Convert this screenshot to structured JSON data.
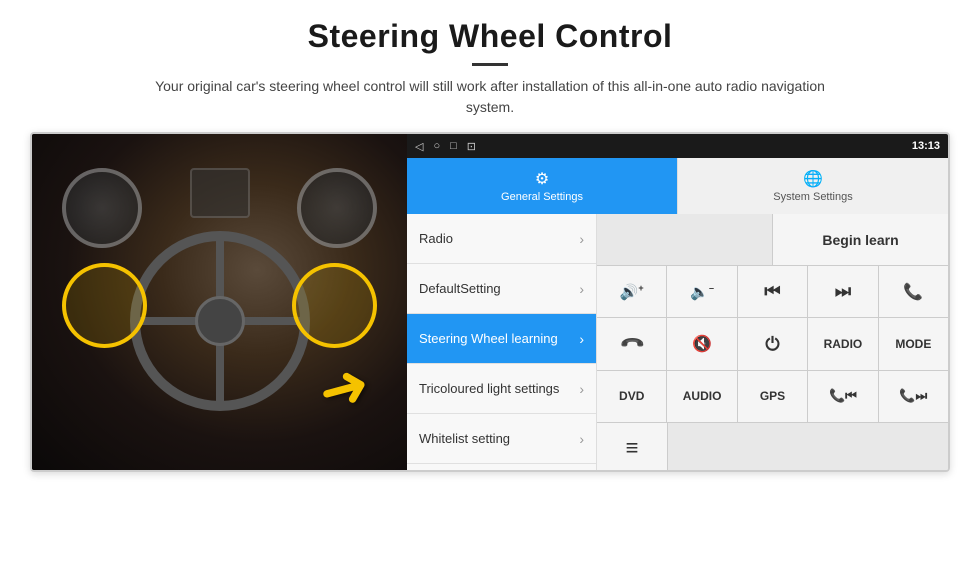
{
  "page": {
    "title": "Steering Wheel Control",
    "divider": true,
    "subtitle": "Your original car's steering wheel control will still work after installation of this all-in-one auto radio navigation system."
  },
  "status_bar": {
    "icons": [
      "◁",
      "○",
      "□",
      "⊡"
    ],
    "right_icons": "♥ ▼",
    "time": "13:13"
  },
  "tabs": {
    "general": {
      "icon": "⚙",
      "label": "General Settings",
      "active": true
    },
    "system": {
      "icon": "🌐",
      "label": "System Settings",
      "active": false
    }
  },
  "menu": {
    "items": [
      {
        "id": "radio",
        "label": "Radio",
        "active": false
      },
      {
        "id": "default-setting",
        "label": "DefaultSetting",
        "active": false
      },
      {
        "id": "steering-wheel",
        "label": "Steering Wheel learning",
        "active": true
      },
      {
        "id": "tricoloured",
        "label": "Tricoloured light settings",
        "active": false
      },
      {
        "id": "whitelist",
        "label": "Whitelist setting",
        "active": false
      }
    ]
  },
  "buttons": {
    "begin_learn": "Begin learn",
    "rows": [
      [
        {
          "id": "vol-up",
          "label": "🔊+",
          "type": "icon"
        },
        {
          "id": "vol-down",
          "label": "🔈-",
          "type": "icon"
        },
        {
          "id": "prev-track",
          "label": "⏮",
          "type": "icon"
        },
        {
          "id": "next-track",
          "label": "⏭",
          "type": "icon"
        },
        {
          "id": "phone-answer",
          "label": "📞",
          "type": "icon"
        }
      ],
      [
        {
          "id": "phone-hangup",
          "label": "↩",
          "type": "icon"
        },
        {
          "id": "mute",
          "label": "🔇",
          "type": "icon"
        },
        {
          "id": "power",
          "label": "⏻",
          "type": "icon"
        },
        {
          "id": "radio-btn",
          "label": "RADIO",
          "type": "text"
        },
        {
          "id": "mode-btn",
          "label": "MODE",
          "type": "text"
        }
      ],
      [
        {
          "id": "dvd-btn",
          "label": "DVD",
          "type": "text"
        },
        {
          "id": "audio-btn",
          "label": "AUDIO",
          "type": "text"
        },
        {
          "id": "gps-btn",
          "label": "GPS",
          "type": "text"
        },
        {
          "id": "tel-prev",
          "label": "📞⏮",
          "type": "icon"
        },
        {
          "id": "tel-next",
          "label": "📞⏭",
          "type": "icon"
        }
      ]
    ],
    "last_row": {
      "id": "menu-icon",
      "label": "≡",
      "type": "icon"
    }
  }
}
